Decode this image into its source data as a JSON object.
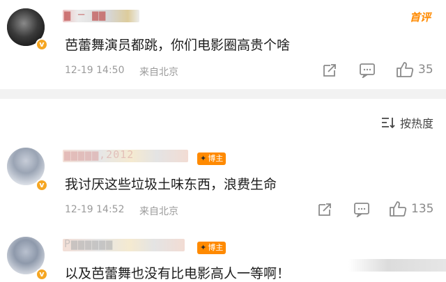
{
  "comments": [
    {
      "username": "▆ ─ ▆▆",
      "badge": "首评",
      "text": "芭蕾舞演员都跳，你们电影圈高贵个啥",
      "time": "12-19 14:50",
      "location": "来自北京",
      "likes": "35"
    },
    {
      "username": "▆▆▆▆▆,2012",
      "tag": "博主",
      "text": "我讨厌这些垃圾土味东西，浪费生命",
      "time": "12-19 14:52",
      "location": "来自北京",
      "likes": "135"
    },
    {
      "username": "Ρ▆▆▆▆▆▆",
      "tag": "博主",
      "text": "以及芭蕾舞也没有比电影高人一等啊！"
    }
  ],
  "sort": {
    "label": "按热度"
  },
  "colors": {
    "accent": "#ff8a00",
    "verified": "#f5a623",
    "divider": "#f2f2f2"
  }
}
